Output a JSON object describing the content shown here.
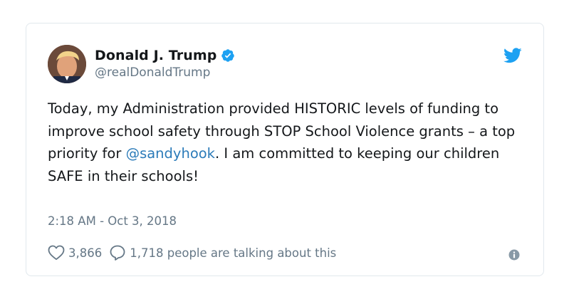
{
  "author": {
    "display_name": "Donald J. Trump",
    "handle": "@realDonaldTrump",
    "verified": true
  },
  "tweet": {
    "text_before_mention": "Today, my Administration provided HISTORIC levels of funding to improve school safety through STOP School Violence grants – a top priority for ",
    "mention": "@sandyhook",
    "text_after_mention": ". I am committed to keeping our children SAFE in their schools!",
    "timestamp": "2:18 AM - Oct 3, 2018"
  },
  "engagement": {
    "likes": "3,866",
    "talking": "1,718 people are talking about this"
  },
  "icons": {
    "brand": "twitter-bird-icon",
    "verified": "verified-badge-icon",
    "like": "heart-icon",
    "reply": "speech-bubble-icon",
    "info": "info-icon"
  },
  "colors": {
    "brand_blue": "#1da1f2",
    "link_blue": "#2b7bb9",
    "muted_gray": "#657786",
    "border": "#e1e8ed"
  }
}
